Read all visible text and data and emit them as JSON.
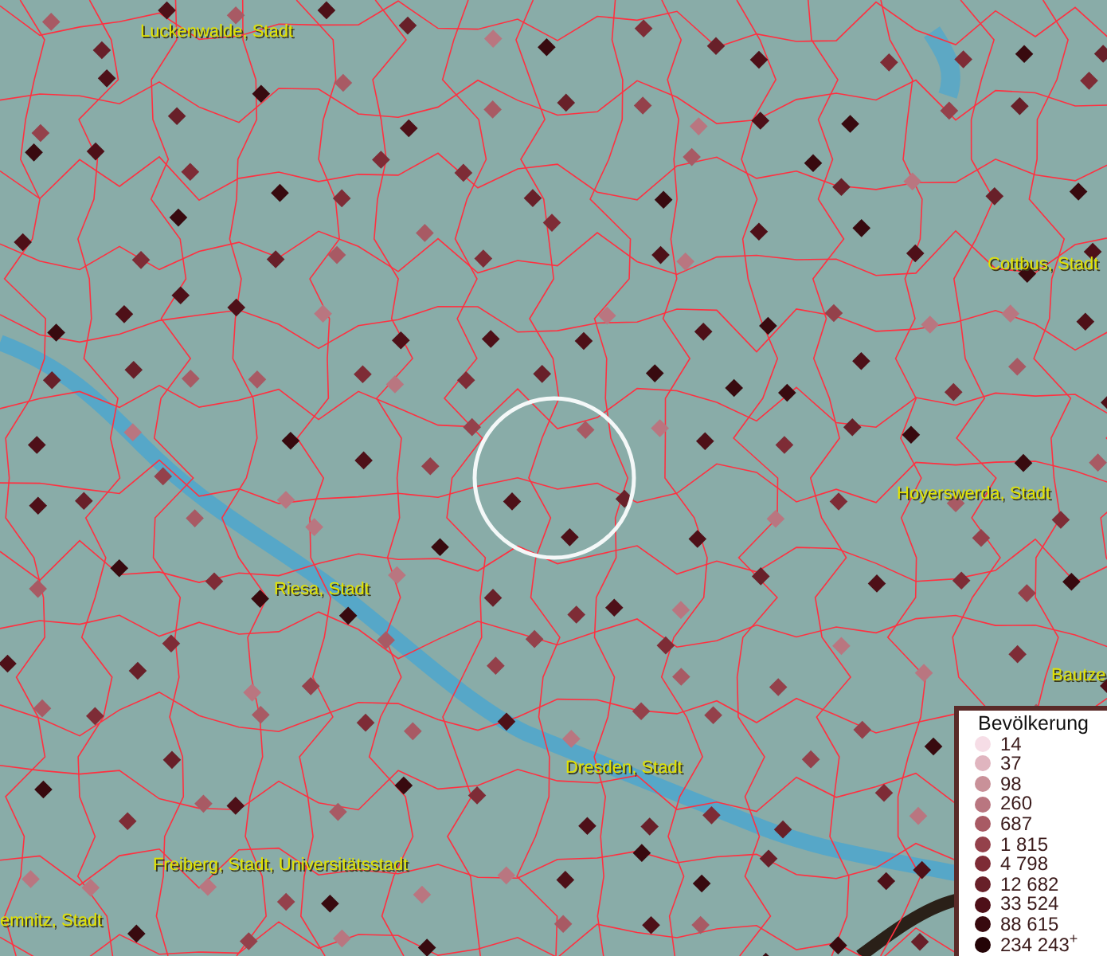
{
  "map_labels": [
    {
      "text": "Luckenwalde, Stadt"
    },
    {
      "text": "Cottbus, Stadt"
    },
    {
      "text": "Hoyerswerda, Stadt"
    },
    {
      "text": "Riesa, Stadt"
    },
    {
      "text": "Bautze"
    },
    {
      "text": "Dresden, Stadt"
    },
    {
      "text": "Freiberg, Stadt, Universitätsstadt"
    },
    {
      "text": "emnitz, Stadt"
    }
  ],
  "legend": {
    "title": "Bevölkerung",
    "items": [
      {
        "label": "14",
        "color": "#f6dde6"
      },
      {
        "label": "37",
        "color": "#e0b5bf"
      },
      {
        "label": "98",
        "color": "#c99199"
      },
      {
        "label": "260",
        "color": "#b97680"
      },
      {
        "label": "687",
        "color": "#a85a64"
      },
      {
        "label": "1 815",
        "color": "#94414b"
      },
      {
        "label": "4 798",
        "color": "#7e2c36"
      },
      {
        "label": "12 682",
        "color": "#682029"
      },
      {
        "label": "33 524",
        "color": "#4e1018"
      },
      {
        "label": "88 615",
        "color": "#380a0f"
      },
      {
        "label": "234 243$^{+}$",
        "color": "#240407"
      }
    ]
  }
}
